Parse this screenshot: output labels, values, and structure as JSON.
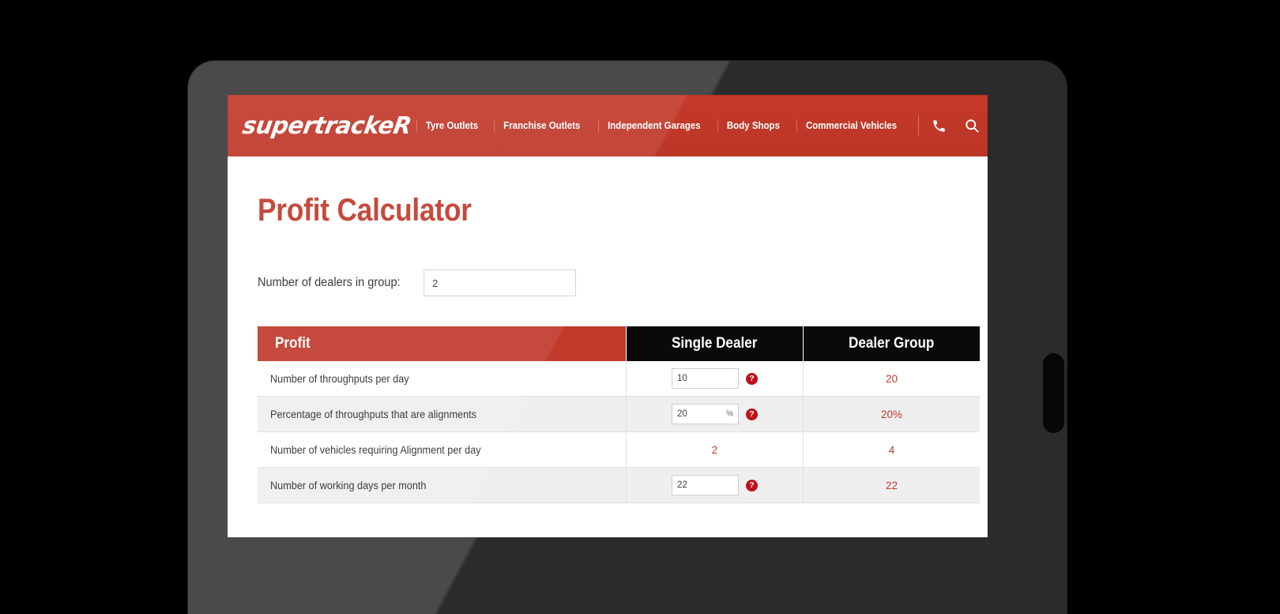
{
  "header": {
    "brand": "supertrackeR",
    "nav_items": [
      {
        "label": "Tyre Outlets"
      },
      {
        "label": "Franchise Outlets"
      },
      {
        "label": "Independent Garages"
      },
      {
        "label": "Body Shops"
      },
      {
        "label": "Commercial Vehicles"
      }
    ],
    "icons": {
      "phone": "phone-icon",
      "search": "search-icon",
      "menu": "hamburger-menu-icon"
    },
    "brand_color": "#c0392b"
  },
  "page": {
    "title": "Profit Calculator"
  },
  "dealers": {
    "label": "Number of dealers in group:",
    "value": "2",
    "placeholder": ""
  },
  "table": {
    "headers": {
      "profit": "Profit",
      "single_dealer": "Single Dealer",
      "dealer_group": "Dealer Group"
    },
    "help_glyph": "?",
    "rows": [
      {
        "label": "Number of throughputs per day",
        "single_type": "input",
        "single_value": "10",
        "single_suffix": "",
        "single_help": true,
        "group_value": "20"
      },
      {
        "label": "Percentage of throughputs that are alignments",
        "single_type": "input",
        "single_value": "20",
        "single_suffix": "%",
        "single_help": true,
        "group_value": "20%"
      },
      {
        "label": "Number of vehicles requiring Alignment per day",
        "single_type": "text",
        "single_value": "2",
        "single_suffix": "",
        "single_help": false,
        "group_value": "4"
      },
      {
        "label": "Number of working days per month",
        "single_type": "input",
        "single_value": "22",
        "single_suffix": "",
        "single_help": true,
        "group_value": "22"
      }
    ]
  }
}
